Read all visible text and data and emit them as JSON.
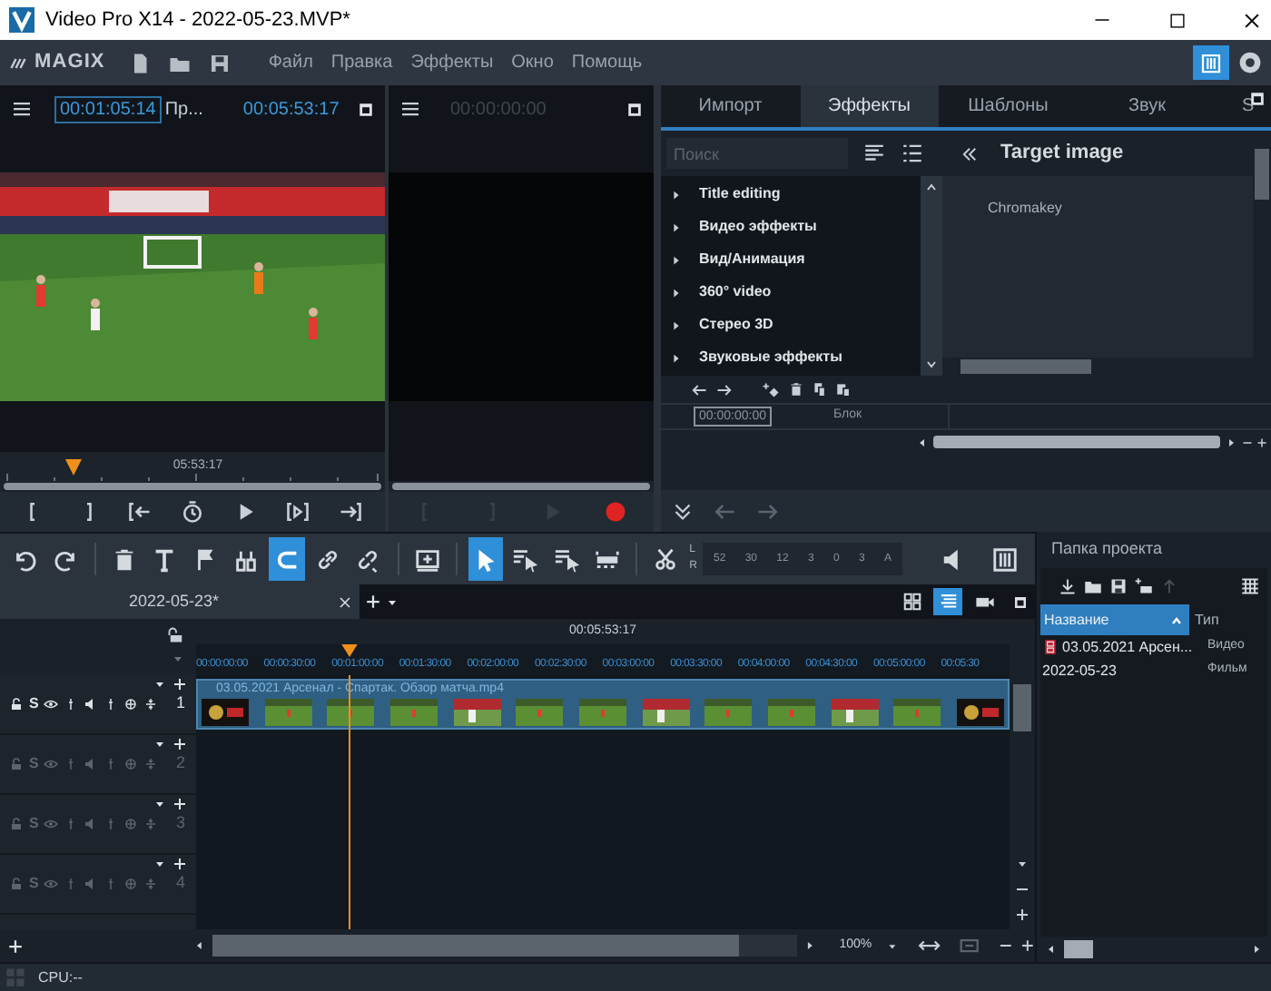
{
  "window": {
    "title": "Video Pro X14 - 2022-05-23.MVP*"
  },
  "app_bar": {
    "logo": "MAGIX",
    "menu": [
      "Файл",
      "Правка",
      "Эффекты",
      "Окно",
      "Помощь"
    ]
  },
  "source_monitor": {
    "timecode": "00:01:05:14",
    "label": "Пр...",
    "duration": "00:05:53:17",
    "ruler_time": "05:53:17",
    "level": 0.19,
    "controls": [
      {
        "kind": "bracket-left",
        "disabled": false
      },
      {
        "kind": "bracket-right",
        "disabled": false
      },
      {
        "kind": "bracket-arrow-left",
        "disabled": false
      },
      {
        "kind": "clock",
        "disabled": false
      },
      {
        "kind": "play",
        "disabled": false
      },
      {
        "kind": "bracket-play",
        "disabled": false
      },
      {
        "kind": "arrow-bracket-right",
        "disabled": false
      }
    ]
  },
  "program_monitor": {
    "timecode": "00:00:00:00",
    "controls": [
      {
        "kind": "bracket-left",
        "disabled": true
      },
      {
        "kind": "bracket-right",
        "disabled": true
      },
      {
        "kind": "play",
        "disabled": true
      },
      {
        "kind": "record",
        "disabled": false
      }
    ]
  },
  "media_pool": {
    "tabs": [
      {
        "label": "Импорт",
        "selected": false
      },
      {
        "label": "Эффекты",
        "selected": true
      },
      {
        "label": "Шаблоны",
        "selected": false
      },
      {
        "label": "Звук",
        "selected": false
      },
      {
        "label": "S",
        "selected": false
      }
    ],
    "search": {
      "placeholder": "Поиск"
    },
    "categories": [
      "Title editing",
      "Видео эффекты",
      "Вид/Анимация",
      "360° video",
      "Стерео 3D",
      "Звуковые эффекты"
    ],
    "detail": {
      "title": "Target image",
      "items": [
        "Chromakey"
      ]
    },
    "timecode": "00:00:00:00",
    "block_label": "Блок"
  },
  "toolbar": {
    "tools": [
      {
        "kind": "undo",
        "selected": false
      },
      {
        "kind": "redo",
        "selected": false
      },
      {
        "kind": "separator"
      },
      {
        "kind": "trash",
        "selected": false
      },
      {
        "kind": "text",
        "selected": false
      },
      {
        "kind": "flag",
        "selected": false
      },
      {
        "kind": "split",
        "selected": false
      },
      {
        "kind": "magnet",
        "selected": true
      },
      {
        "kind": "link",
        "selected": false
      },
      {
        "kind": "unlink",
        "selected": false
      },
      {
        "kind": "separator"
      },
      {
        "kind": "insert",
        "selected": false
      },
      {
        "kind": "separator"
      },
      {
        "kind": "pointer",
        "selected": true
      },
      {
        "kind": "range-pointer",
        "selected": false
      },
      {
        "kind": "multi-pointer",
        "selected": false
      },
      {
        "kind": "stretch",
        "selected": false
      },
      {
        "kind": "separator"
      },
      {
        "kind": "scissors",
        "selected": false
      }
    ],
    "meter": {
      "left": "L",
      "right": "R",
      "scale": [
        "52",
        "30",
        "12",
        "3",
        "0",
        "3",
        "A"
      ]
    },
    "tools_right": [
      {
        "kind": "speaker",
        "selected": false
      },
      {
        "kind": "mixer",
        "selected": false
      }
    ]
  },
  "arrangement": {
    "tab": "2022-05-23*",
    "duration": "00:05:53:17",
    "ruler": [
      "00:00:00:00",
      "00:00:30:00",
      "00:01:00:00",
      "00:01:30:00",
      "00:02:00:00",
      "00:02:30:00",
      "00:03:00:00",
      "00:03:30:00",
      "00:04:00:00",
      "00:04:30:00",
      "00:05:00:00",
      "00:05:30"
    ],
    "level": 0.188,
    "view_modes": [
      {
        "kind": "storyboard",
        "selected": false
      },
      {
        "kind": "timeline",
        "selected": true
      },
      {
        "kind": "camera",
        "selected": false
      }
    ],
    "tracks": [
      {
        "number": "1",
        "solo_label": "S",
        "active": true
      },
      {
        "number": "2",
        "solo_label": "S",
        "active": false
      },
      {
        "number": "3",
        "solo_label": "S",
        "active": false
      },
      {
        "number": "4",
        "solo_label": "S",
        "active": false
      }
    ],
    "clip": {
      "title": "03.05.2021 Арсенал - Спартак. Обзор матча.mp4",
      "thumbnails": [
        {
          "kind": "logo"
        },
        {
          "kind": "field"
        },
        {
          "kind": "field"
        },
        {
          "kind": "field"
        },
        {
          "kind": "crowd"
        },
        {
          "kind": "field"
        },
        {
          "kind": "field"
        },
        {
          "kind": "crowd"
        },
        {
          "kind": "field"
        },
        {
          "kind": "field"
        },
        {
          "kind": "crowd"
        },
        {
          "kind": "field"
        },
        {
          "kind": "logo"
        }
      ]
    },
    "zoom": "100%"
  },
  "project": {
    "title": "Папка проекта",
    "columns": [
      "Название",
      "Тип"
    ],
    "rows": [
      {
        "name": "03.05.2021 Арсен...",
        "type": "Видео",
        "kind": "video"
      },
      {
        "name": "2022-05-23",
        "type": "Фильм",
        "kind": "movie"
      }
    ]
  },
  "status": "CPU:--"
}
